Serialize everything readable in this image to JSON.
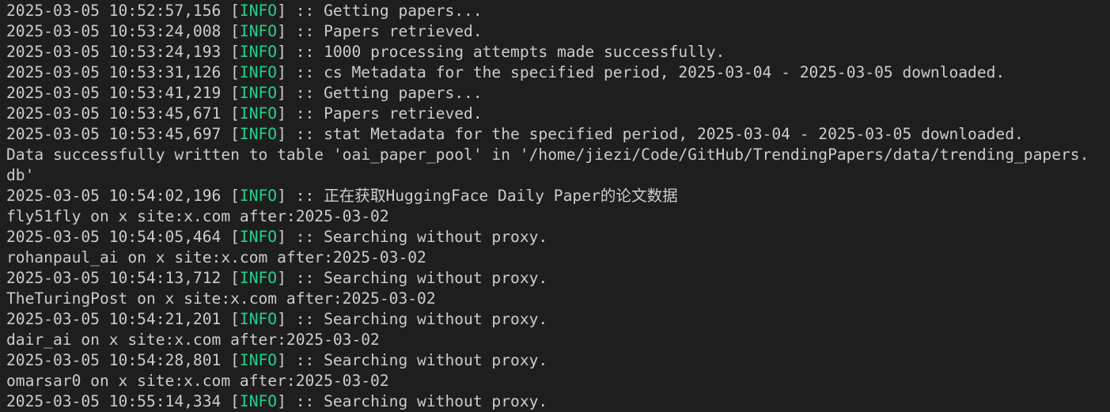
{
  "colors": {
    "background": "#1e1e1e",
    "text": "#cccccc",
    "info": "#23d18b"
  },
  "lines": [
    {
      "ts": "2025-03-05 10:52:57,156",
      "level": "INFO",
      "msg": "Getting papers..."
    },
    {
      "ts": "2025-03-05 10:53:24,008",
      "level": "INFO",
      "msg": "Papers retrieved."
    },
    {
      "ts": "2025-03-05 10:53:24,193",
      "level": "INFO",
      "msg": "1000 processing attempts made successfully."
    },
    {
      "ts": "2025-03-05 10:53:31,126",
      "level": "INFO",
      "msg": "cs Metadata for the specified period, 2025-03-04 - 2025-03-05 downloaded."
    },
    {
      "ts": "2025-03-05 10:53:41,219",
      "level": "INFO",
      "msg": "Getting papers..."
    },
    {
      "ts": "2025-03-05 10:53:45,671",
      "level": "INFO",
      "msg": "Papers retrieved."
    },
    {
      "ts": "2025-03-05 10:53:45,697",
      "level": "INFO",
      "msg": "stat Metadata for the specified period, 2025-03-04 - 2025-03-05 downloaded."
    },
    {
      "text": "Data successfully written to table 'oai_paper_pool' in '/home/jiezi/Code/GitHub/TrendingPapers/data/trending_papers."
    },
    {
      "text": "db'"
    },
    {
      "ts": "2025-03-05 10:54:02,196",
      "level": "INFO",
      "msg": "正在获取HuggingFace Daily Paper的论文数据"
    },
    {
      "text": "fly51fly on x site:x.com after:2025-03-02"
    },
    {
      "ts": "2025-03-05 10:54:05,464",
      "level": "INFO",
      "msg": "Searching without proxy."
    },
    {
      "text": "rohanpaul_ai on x site:x.com after:2025-03-02"
    },
    {
      "ts": "2025-03-05 10:54:13,712",
      "level": "INFO",
      "msg": "Searching without proxy."
    },
    {
      "text": "TheTuringPost on x site:x.com after:2025-03-02"
    },
    {
      "ts": "2025-03-05 10:54:21,201",
      "level": "INFO",
      "msg": "Searching without proxy."
    },
    {
      "text": "dair_ai on x site:x.com after:2025-03-02"
    },
    {
      "ts": "2025-03-05 10:54:28,801",
      "level": "INFO",
      "msg": "Searching without proxy."
    },
    {
      "text": "omarsar0 on x site:x.com after:2025-03-02"
    },
    {
      "ts": "2025-03-05 10:55:14,334",
      "level": "INFO",
      "msg": "Searching without proxy."
    }
  ]
}
